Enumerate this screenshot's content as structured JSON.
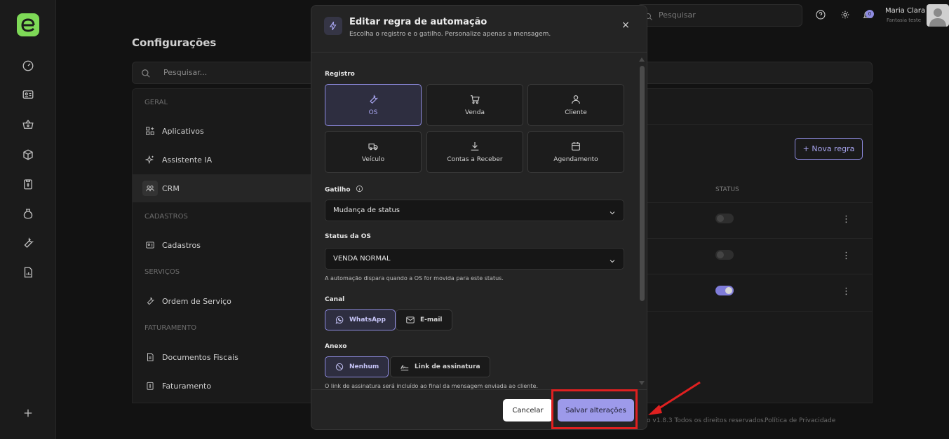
{
  "sidebar": {
    "icons": [
      "dashboard-icon",
      "id-card-icon",
      "basket-icon",
      "box-icon",
      "clipboard-icon",
      "bag-icon",
      "wrench-icon",
      "report-icon",
      "plus-icon"
    ]
  },
  "page": {
    "title": "Configurações",
    "search_placeholder": "Pesquisar..."
  },
  "settings_nav": {
    "sections": [
      {
        "name": "GERAL",
        "items": [
          "Aplicativos",
          "Assistente IA",
          "CRM"
        ]
      },
      {
        "name": "CADASTROS",
        "items": [
          "Cadastros"
        ]
      },
      {
        "name": "SERVIÇOS",
        "items": [
          "Ordem de Serviço"
        ]
      },
      {
        "name": "FATURAMENTO",
        "items": [
          "Documentos Fiscais",
          "Faturamento"
        ]
      }
    ],
    "active": "CRM"
  },
  "content": {
    "new_rule_label": "+ Nova regra",
    "status_header": "STATUS",
    "rows": [
      {
        "status_on": false
      },
      {
        "status_on": false
      },
      {
        "status_on": true
      }
    ],
    "kebab": "⋮"
  },
  "header": {
    "search_placeholder": "Pesquisar",
    "notif_count": "0",
    "user_name": "Maria Clara",
    "user_sub": "Fantasia teste"
  },
  "footer": {
    "version": "o v1.8.3 Todos os direitos reservados.",
    "privacy": "Política de Privacidade"
  },
  "modal": {
    "title": "Editar regra de automação",
    "subtitle": "Escolha o registro e o gatilho. Personalize apenas a mensagem.",
    "close": "×",
    "registro_label": "Registro",
    "registros": [
      {
        "label": "OS",
        "icon": "wrench-icon",
        "selected": true
      },
      {
        "label": "Venda",
        "icon": "cart-icon",
        "selected": false
      },
      {
        "label": "Cliente",
        "icon": "user-icon",
        "selected": false
      },
      {
        "label": "Veículo",
        "icon": "truck-icon",
        "selected": false
      },
      {
        "label": "Contas a Receber",
        "icon": "download-icon",
        "selected": false
      },
      {
        "label": "Agendamento",
        "icon": "calendar-icon",
        "selected": false
      }
    ],
    "gatilho_label": "Gatilho",
    "gatilho_value": "Mudança de status",
    "status_label": "Status da OS",
    "status_value": "VENDA NORMAL",
    "status_help": "A automação dispara quando a OS for movida para este status.",
    "canal_label": "Canal",
    "canais": [
      {
        "label": "WhatsApp",
        "selected": true
      },
      {
        "label": "E-mail",
        "selected": false
      }
    ],
    "anexo_label": "Anexo",
    "anexos": [
      {
        "label": "Nenhum",
        "selected": true
      },
      {
        "label": "Link de assinatura",
        "selected": false
      }
    ],
    "anexo_help": "O link de assinatura será incluído ao final da mensagem enviada ao cliente.",
    "cancel_label": "Cancelar",
    "save_label": "Salvar alterações"
  },
  "colors": {
    "accent": "#8e8be0",
    "logo": "#7ed957",
    "highlight": "#e02020"
  }
}
